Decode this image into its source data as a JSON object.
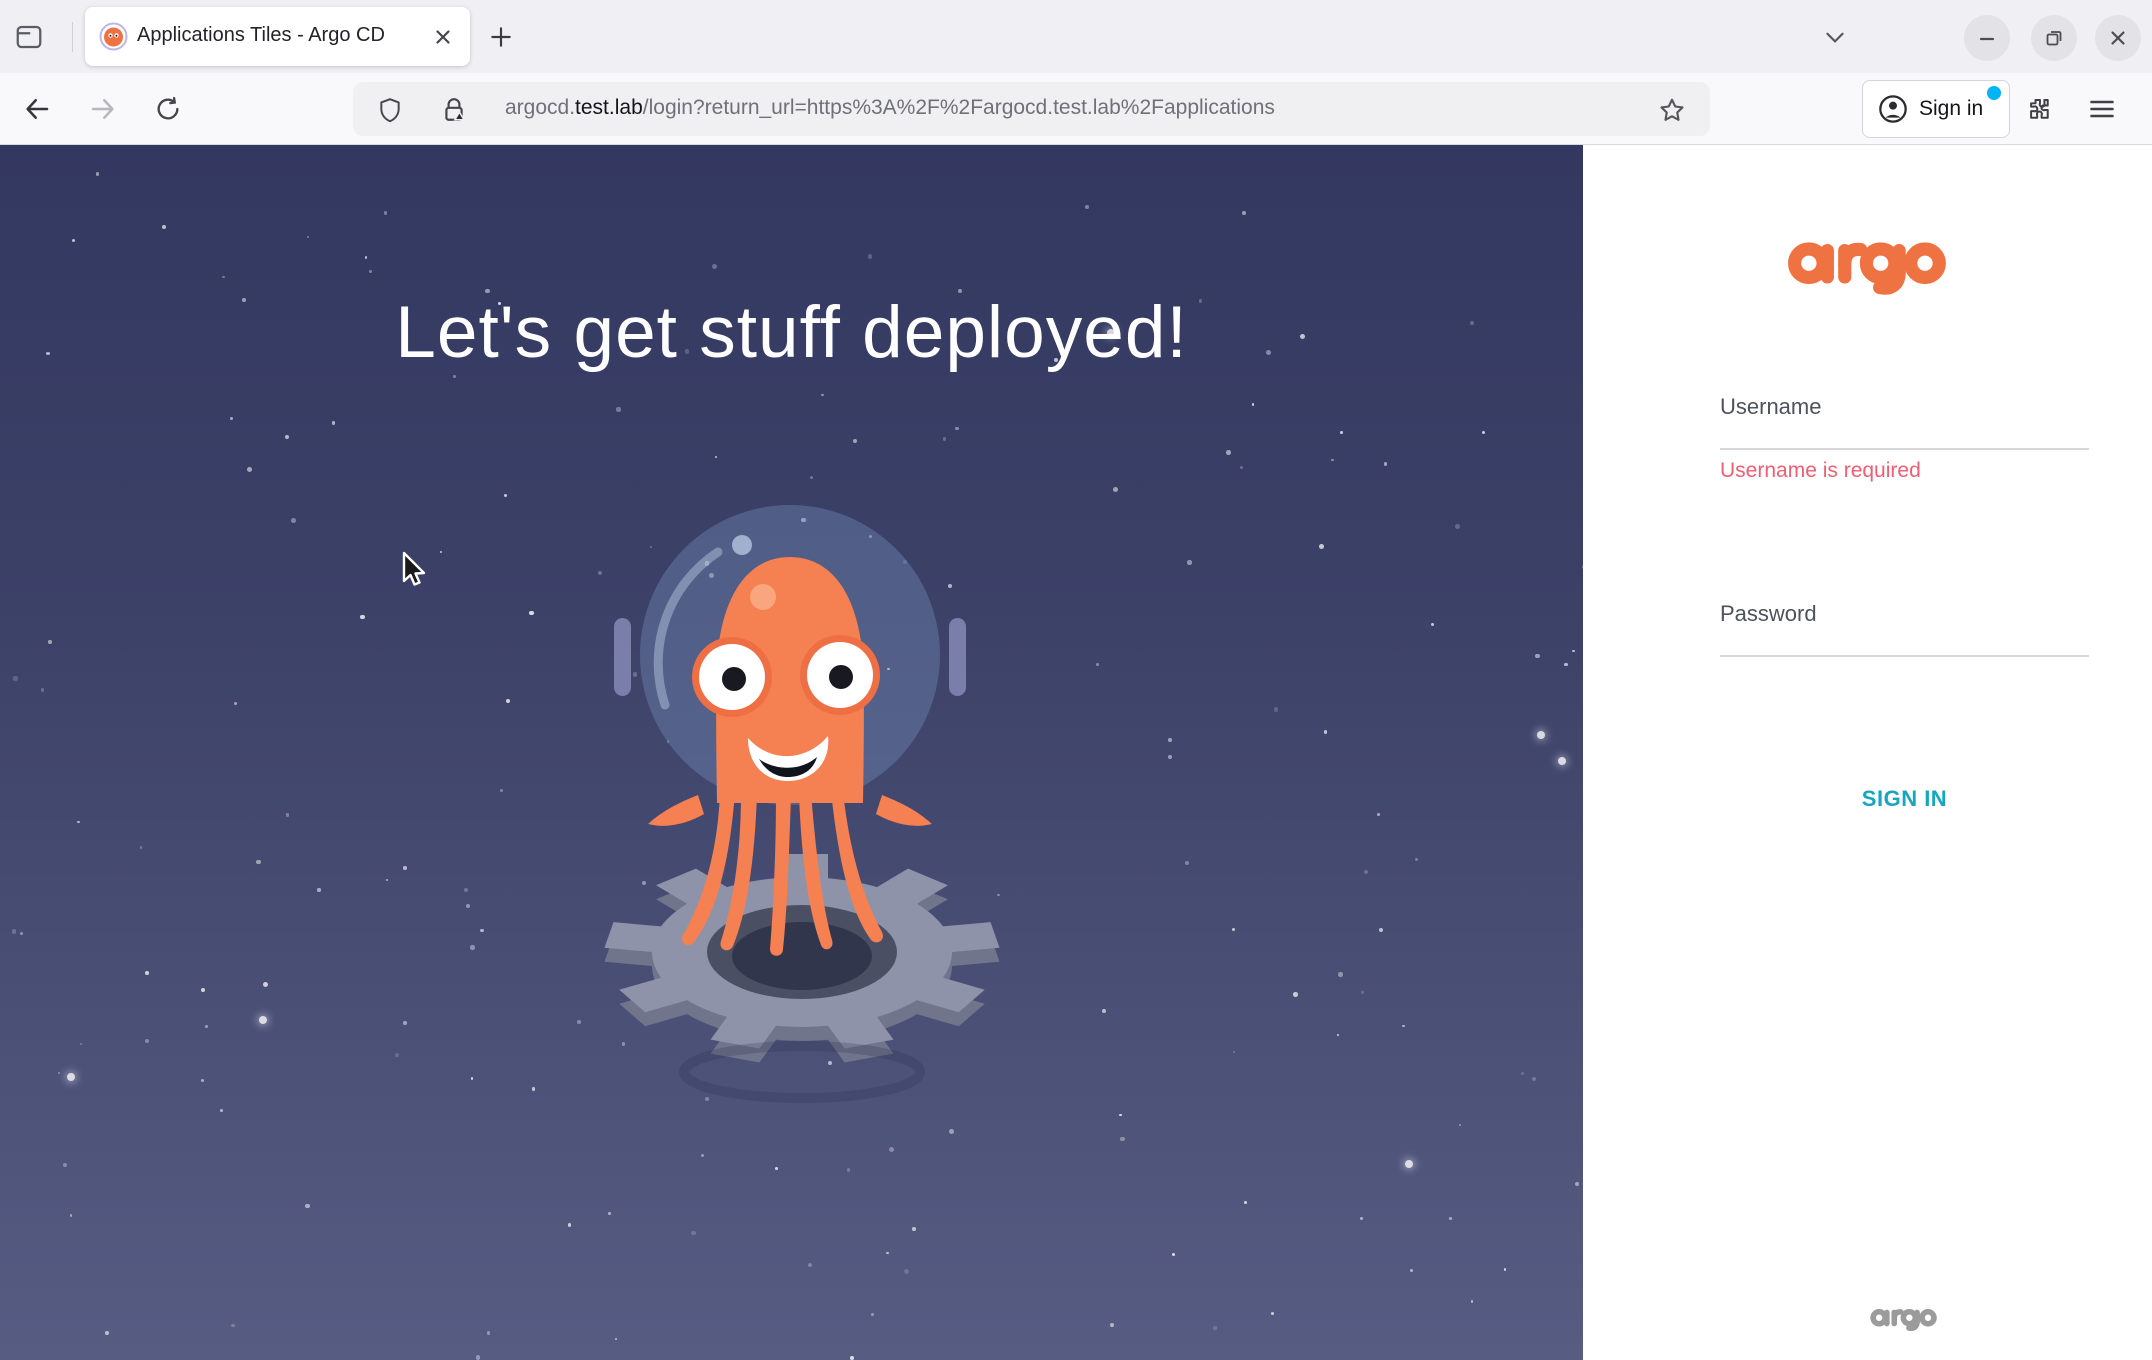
{
  "browser": {
    "fxview_tooltip": "firefox-view",
    "tab": {
      "title": "Applications Tiles - Argo CD"
    },
    "url": {
      "subdomain": "argocd.",
      "domain": "test.lab",
      "path": "/login?return_url=https%3A%2F%2Fargocd.test.lab%2Fapplications"
    },
    "signin_label": "Sign in"
  },
  "page": {
    "headline": "Let's get stuff deployed!",
    "brand": "argo",
    "form": {
      "username_label": "Username",
      "username_error": "Username is required",
      "password_label": "Password",
      "signin_button": "SIGN IN"
    }
  },
  "colors": {
    "argo_orange": "#ef7342",
    "signin_teal": "#18a5bd",
    "error_pink": "#ef5e73",
    "notification_blue": "#00b4f7",
    "space_top": "#333860",
    "space_bottom": "#575c83",
    "octopus_orange": "#f58052"
  }
}
